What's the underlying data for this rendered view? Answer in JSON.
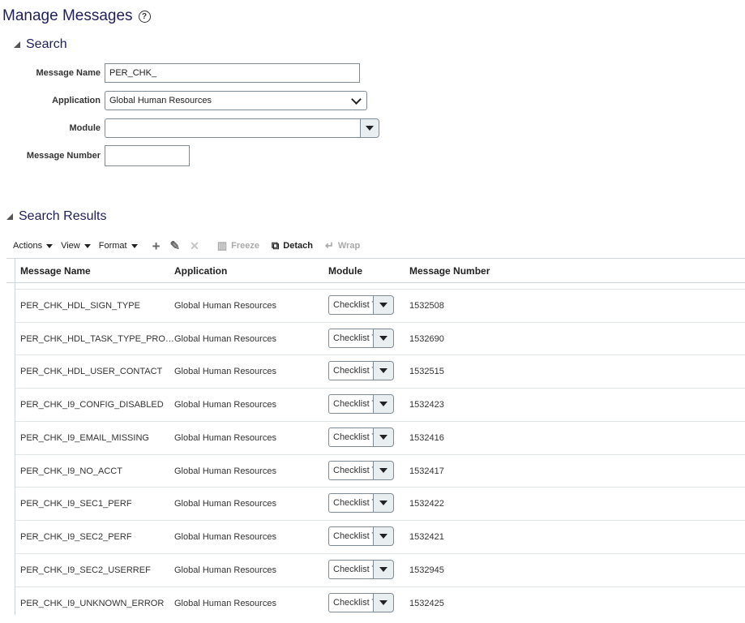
{
  "page": {
    "title": "Manage Messages",
    "help_icon": "?"
  },
  "search": {
    "header": "Search",
    "fields": {
      "message_name": {
        "label": "Message Name",
        "value": "PER_CHK_"
      },
      "application": {
        "label": "Application",
        "value": "Global Human Resources"
      },
      "module": {
        "label": "Module",
        "value": ""
      },
      "message_number": {
        "label": "Message Number",
        "value": ""
      }
    }
  },
  "results": {
    "header": "Search Results",
    "toolbar": {
      "actions": "Actions",
      "view": "View",
      "format": "Format",
      "add_icon": "+",
      "edit_icon": "✎",
      "delete_icon": "✕",
      "freeze": "Freeze",
      "detach": "Detach",
      "wrap": "Wrap"
    },
    "columns": [
      "Message Name",
      "Application",
      "Module",
      "Message Number"
    ],
    "rows": [
      {
        "name": "PER_CHK_HDL_SIGN_TYPE",
        "application": "Global Human Resources",
        "module": "Checklist T",
        "number": "1532508"
      },
      {
        "name": "PER_CHK_HDL_TASK_TYPE_PRO…",
        "application": "Global Human Resources",
        "module": "Checklist T",
        "number": "1532690"
      },
      {
        "name": "PER_CHK_HDL_USER_CONTACT",
        "application": "Global Human Resources",
        "module": "Checklist T",
        "number": "1532515"
      },
      {
        "name": "PER_CHK_I9_CONFIG_DISABLED",
        "application": "Global Human Resources",
        "module": "Checklist T",
        "number": "1532423"
      },
      {
        "name": "PER_CHK_I9_EMAIL_MISSING",
        "application": "Global Human Resources",
        "module": "Checklist T",
        "number": "1532416"
      },
      {
        "name": "PER_CHK_I9_NO_ACCT",
        "application": "Global Human Resources",
        "module": "Checklist T",
        "number": "1532417"
      },
      {
        "name": "PER_CHK_I9_SEC1_PERF",
        "application": "Global Human Resources",
        "module": "Checklist T",
        "number": "1532422"
      },
      {
        "name": "PER_CHK_I9_SEC2_PERF",
        "application": "Global Human Resources",
        "module": "Checklist T",
        "number": "1532421"
      },
      {
        "name": "PER_CHK_I9_SEC2_USERREF",
        "application": "Global Human Resources",
        "module": "Checklist T",
        "number": "1532945"
      },
      {
        "name": "PER_CHK_I9_UNKNOWN_ERROR",
        "application": "Global Human Resources",
        "module": "Checklist T",
        "number": "1532425"
      }
    ]
  }
}
